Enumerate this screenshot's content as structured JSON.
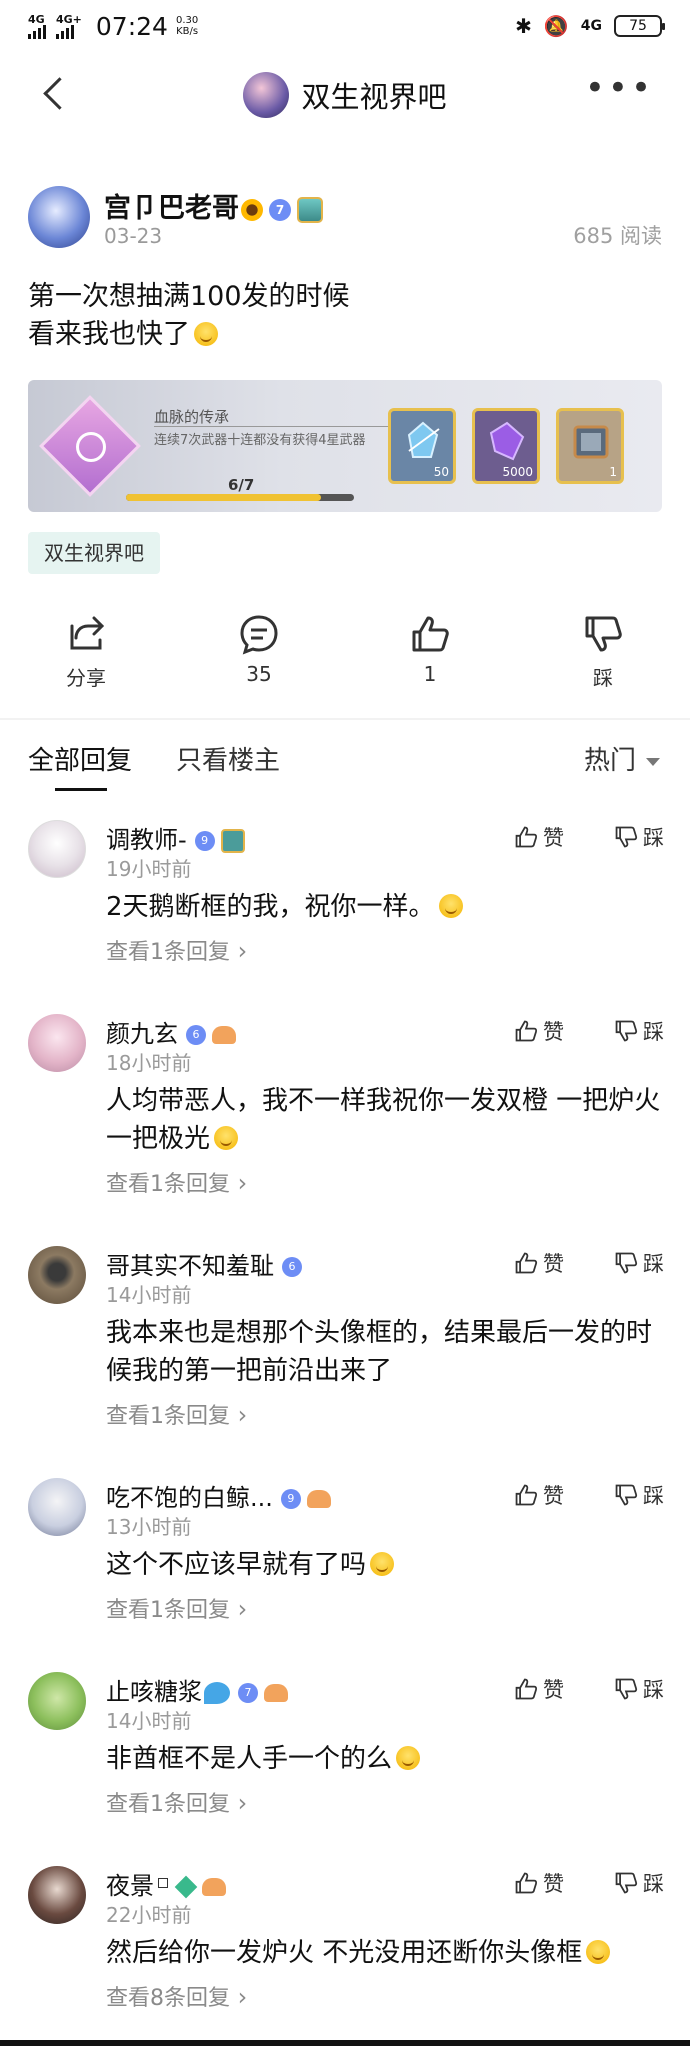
{
  "status_bar": {
    "network1": "4G",
    "network2": "4G+",
    "time": "07:24",
    "speed_value": "0.30",
    "speed_unit": "KB/s",
    "network3": "4G",
    "battery": "75"
  },
  "nav": {
    "title": "双生视界吧"
  },
  "post": {
    "author": "宫卩巴老哥",
    "level": "7",
    "date": "03-23",
    "reads": "685 阅读",
    "text_line1": "第一次想抽满100发的时候",
    "text_line2": "看来我也快了",
    "forum_tag": "双生视界吧"
  },
  "achievement": {
    "title": "血脉的传承",
    "description": "连续7次武器十连都没有获得4星武器",
    "progress_text": "6/7",
    "progress_fraction": 0.857,
    "rewards": [
      {
        "qty": "50",
        "icon": "crystal-icon"
      },
      {
        "qty": "5000",
        "icon": "purple-gem-icon"
      },
      {
        "qty": "1",
        "icon": "avatar-frame-icon"
      }
    ]
  },
  "actions": {
    "share": "分享",
    "comments": "35",
    "likes": "1",
    "dislike": "踩"
  },
  "tabs": {
    "all": "全部回复",
    "op_only": "只看楼主",
    "sort": "热门"
  },
  "comment_labels": {
    "like": "赞",
    "dislike": "踩"
  },
  "comments": [
    {
      "name": "调教师-",
      "level": "9",
      "time": "19小时前",
      "text": "2天鹅断框的我，祝你一样。",
      "more": "查看1条回复"
    },
    {
      "name": "颜九玄",
      "level": "6",
      "time": "18小时前",
      "text": "人均带恶人，我不一样我祝你一发双橙 一把炉火一把极光",
      "more": "查看1条回复"
    },
    {
      "name": "哥其实不知羞耻",
      "level": "6",
      "time": "14小时前",
      "text": "我本来也是想那个头像框的，结果最后一发的时候我的第一把前沿出来了",
      "more": "查看1条回复"
    },
    {
      "name": "吃不饱的白鲸...",
      "level": "9",
      "time": "13小时前",
      "text": "这个不应该早就有了吗",
      "more": "查看1条回复"
    },
    {
      "name": "止咳糖浆",
      "level": "7",
      "time": "14小时前",
      "text": "非酋框不是人手一个的么",
      "more": "查看1条回复"
    },
    {
      "name": "夜景",
      "level": "",
      "time": "22小时前",
      "text": "然后给你一发炉火 不光没用还断你头像框",
      "more": "查看8条回复"
    }
  ],
  "colors": {
    "tag_bg": "#e6f4f1",
    "level_blue": "#6d8df5",
    "progress_yellow": "#f0c232"
  }
}
